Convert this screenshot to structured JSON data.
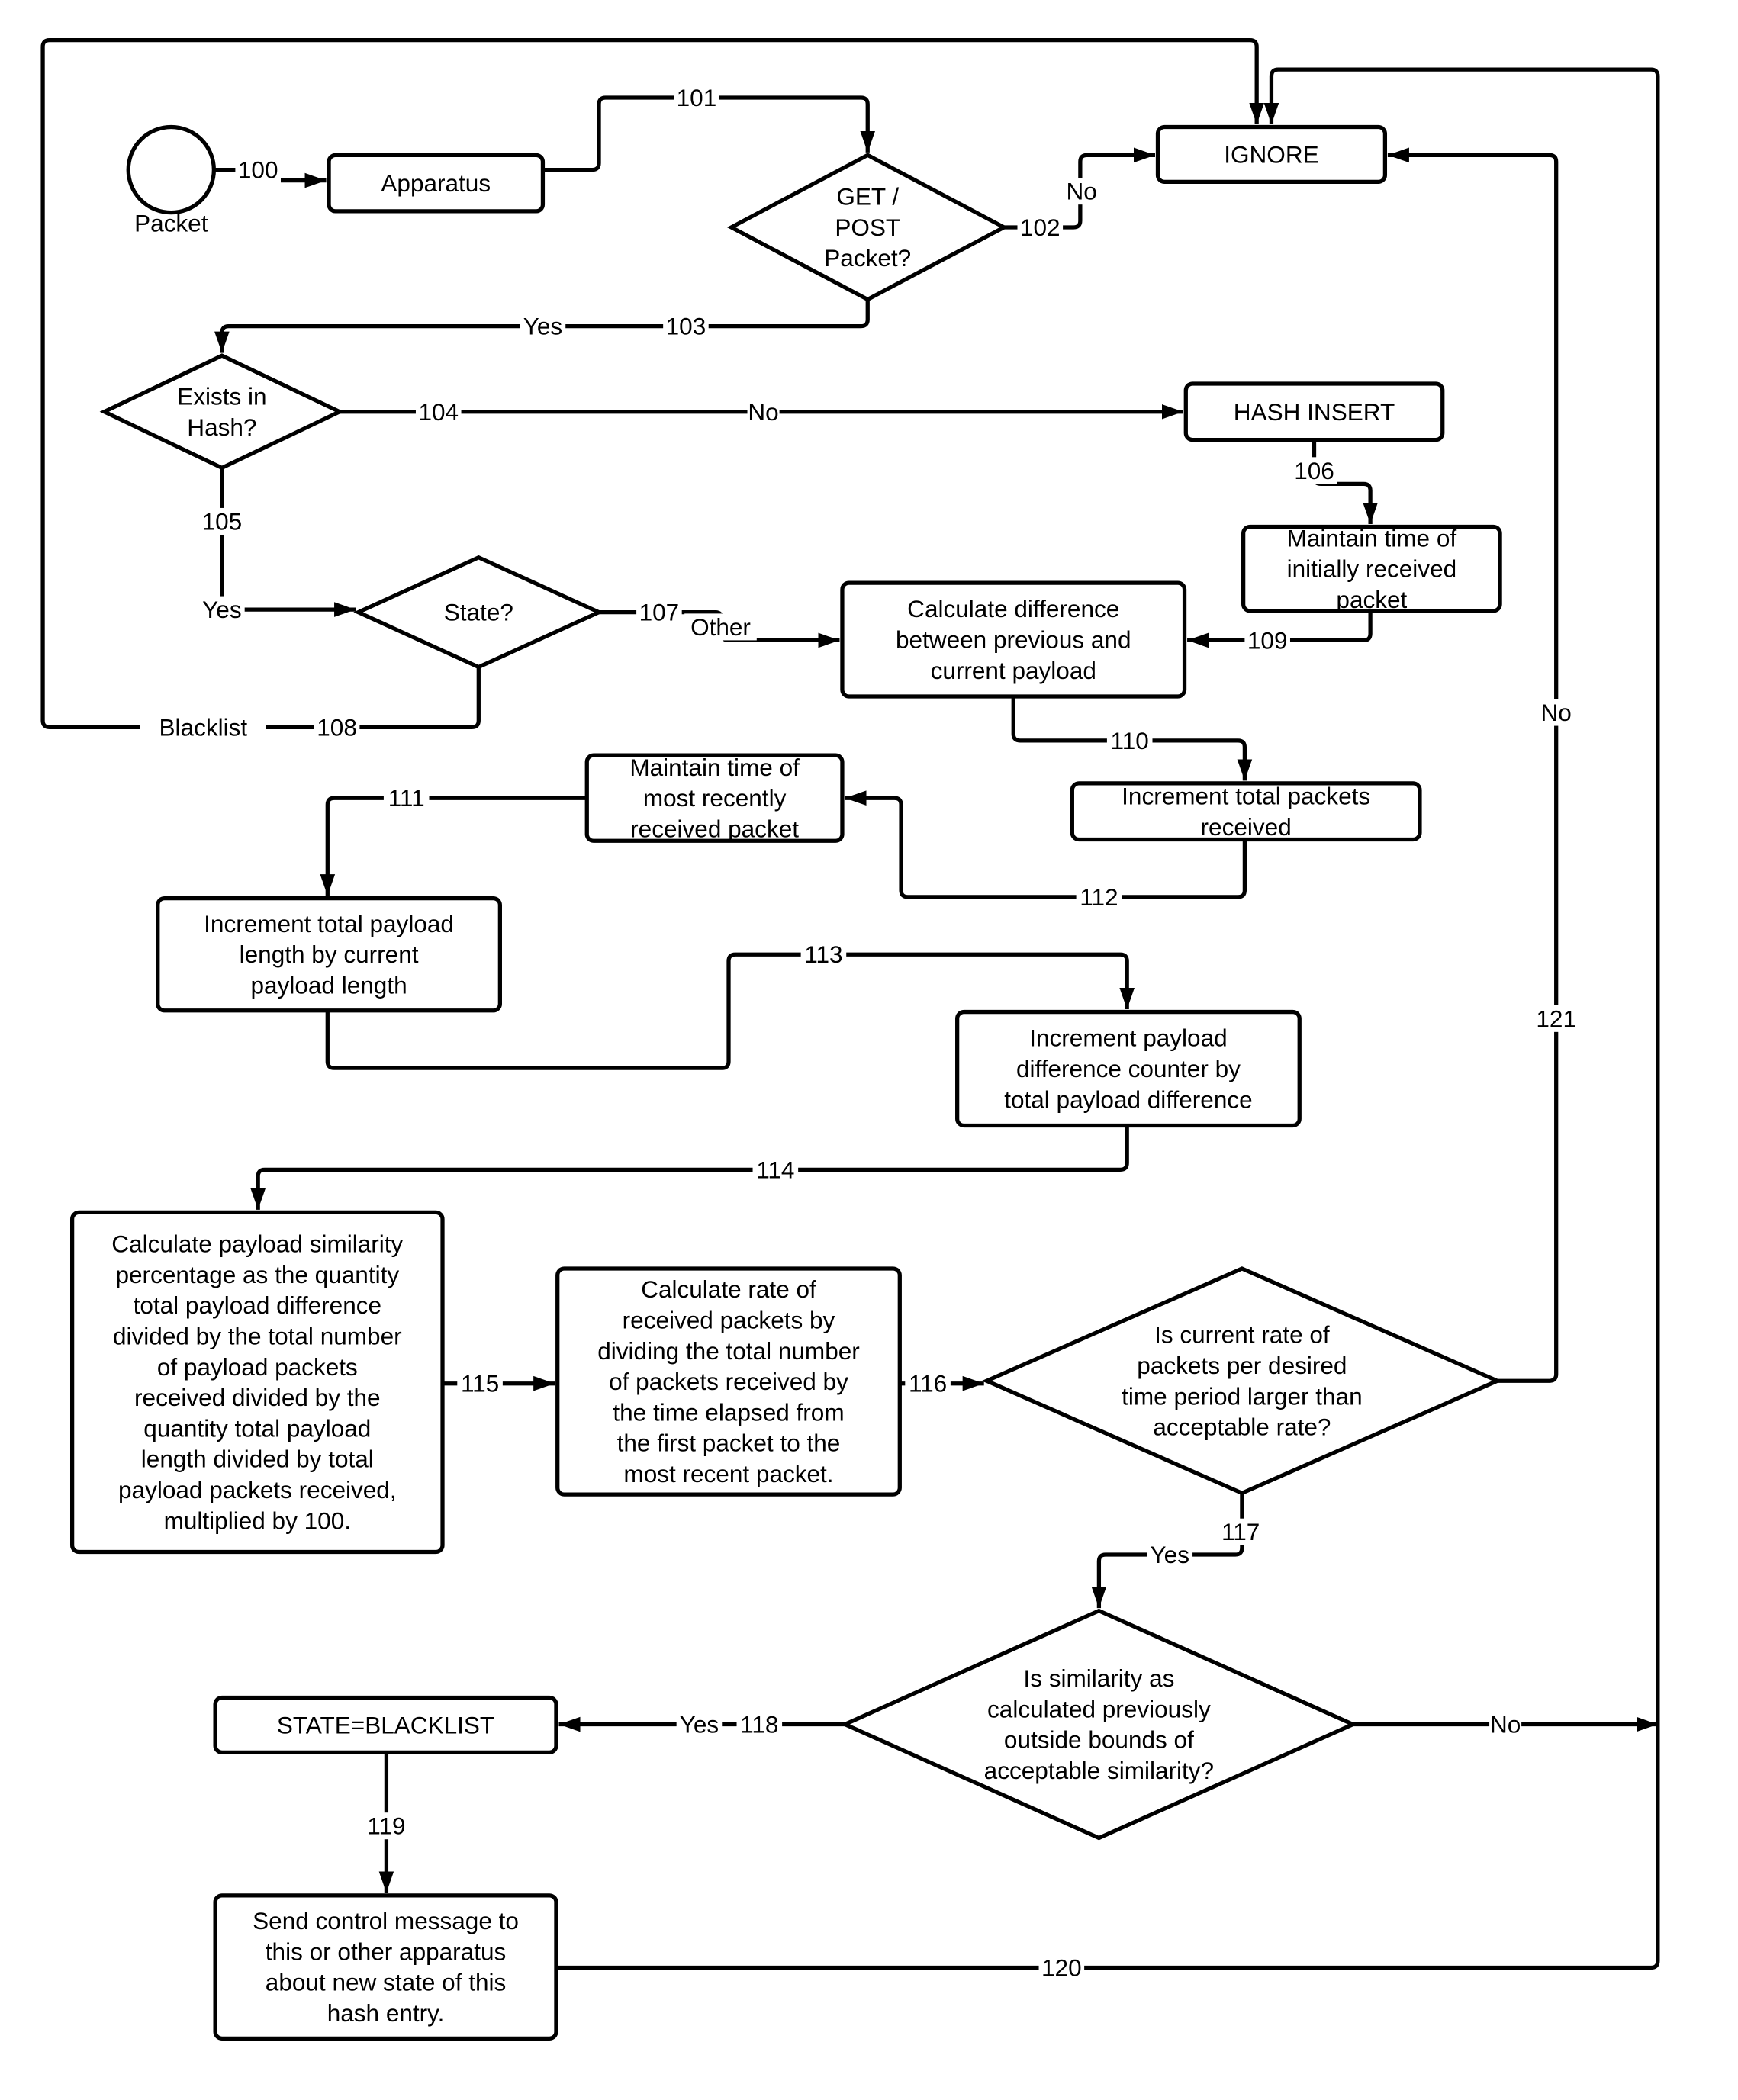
{
  "diagram": {
    "colors": {
      "stroke": "#000000",
      "background": "#ffffff"
    },
    "nodes": {
      "packet": {
        "label": "Packet",
        "shape": "circle"
      },
      "apparatus": {
        "label": "Apparatus",
        "shape": "rounded-rect"
      },
      "get_post": {
        "lines": [
          "GET /",
          "POST",
          "Packet?"
        ],
        "shape": "diamond"
      },
      "ignore": {
        "label": "IGNORE",
        "shape": "rounded-rect"
      },
      "exists_in_hash": {
        "lines": [
          "Exists in",
          "Hash?"
        ],
        "shape": "diamond"
      },
      "hash_insert": {
        "label": "HASH INSERT",
        "shape": "rounded-rect"
      },
      "maintain_initial": {
        "lines": [
          "Maintain time of",
          "initially received",
          "packet"
        ],
        "shape": "rounded-rect"
      },
      "state": {
        "label": "State?",
        "shape": "diamond"
      },
      "calc_difference": {
        "lines": [
          "Calculate difference",
          "between previous and",
          "current payload"
        ],
        "shape": "rounded-rect"
      },
      "increment_packets": {
        "lines": [
          "Increment total packets",
          "received"
        ],
        "shape": "rounded-rect"
      },
      "maintain_recent": {
        "lines": [
          "Maintain time of",
          "most recently",
          "received packet"
        ],
        "shape": "rounded-rect"
      },
      "increment_payload_length": {
        "lines": [
          "Increment total payload",
          "length by current",
          "payload length"
        ],
        "shape": "rounded-rect"
      },
      "increment_diff_counter": {
        "lines": [
          "Increment payload",
          "difference counter by",
          "total payload difference"
        ],
        "shape": "rounded-rect"
      },
      "calc_similarity": {
        "lines": [
          "Calculate payload similarity",
          "percentage as the quantity",
          "total payload difference",
          "divided by the total number",
          "of payload packets",
          "received divided by the",
          "quantity total payload",
          "length divided by total",
          "payload packets received,",
          "multiplied by 100."
        ],
        "shape": "rounded-rect"
      },
      "calc_rate": {
        "lines": [
          "Calculate rate of",
          "received packets by",
          "dividing the total number",
          "of packets received by",
          "the time elapsed from",
          "the first packet to the",
          "most recent packet."
        ],
        "shape": "rounded-rect"
      },
      "rate_check": {
        "lines": [
          "Is current rate of",
          "packets per desired",
          "time period larger than",
          "acceptable rate?"
        ],
        "shape": "diamond"
      },
      "similarity_check": {
        "lines": [
          "Is similarity as",
          "calculated previously",
          "outside bounds of",
          "acceptable similarity?"
        ],
        "shape": "diamond"
      },
      "state_blacklist": {
        "label": "STATE=BLACKLIST",
        "shape": "rounded-rect"
      },
      "send_control": {
        "lines": [
          "Send control message to",
          "this or other apparatus",
          "about new state of this",
          "hash entry."
        ],
        "shape": "rounded-rect"
      }
    },
    "edge_labels": {
      "e100": "100",
      "e101": "101",
      "e102": "102",
      "e102_cond": "No",
      "e103": "103",
      "e103_cond": "Yes",
      "e104": "104",
      "e104_cond": "No",
      "e105": "105",
      "e105_cond": "Yes",
      "e106": "106",
      "e107": "107",
      "e107_cond": "Other",
      "e108": "108",
      "e108_cond": "Blacklist",
      "e109": "109",
      "e110": "110",
      "e111": "111",
      "e112": "112",
      "e113": "113",
      "e114": "114",
      "e115": "115",
      "e116": "116",
      "e117": "117",
      "e117_cond": "Yes",
      "e118": "118",
      "e118_cond": "Yes",
      "e118_no": "No",
      "e119": "119",
      "e120": "120",
      "e121": "121",
      "e121_cond": "No"
    }
  }
}
